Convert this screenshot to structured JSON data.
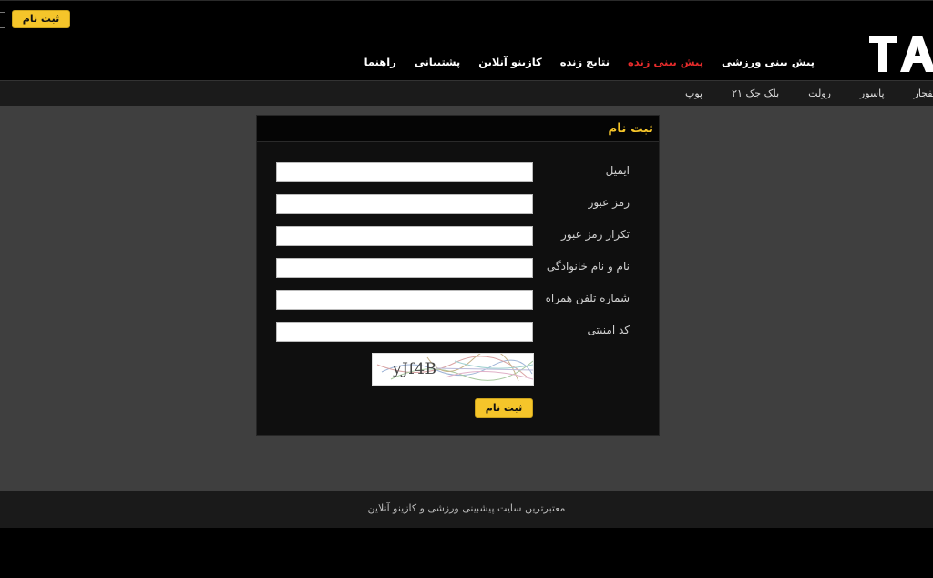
{
  "header": {
    "register_button": "ثبت نام",
    "logo_text": "TA",
    "nav": [
      {
        "label": "پیش بینی ورزشی"
      },
      {
        "label": "پیش بینی زنده"
      },
      {
        "label": "نتایج زنده"
      },
      {
        "label": "کازینو آنلاین"
      },
      {
        "label": "پشتیبانی"
      },
      {
        "label": "راهنما"
      }
    ],
    "nav_active_index": 1
  },
  "subnav": {
    "items": [
      {
        "label": "انفجار"
      },
      {
        "label": "پاسور"
      },
      {
        "label": "رولت"
      },
      {
        "label": "بلک جک ۲۱"
      },
      {
        "label": "پوپ"
      }
    ]
  },
  "form": {
    "title": "ثبت نام",
    "fields": [
      {
        "label": "ایمیل",
        "value": "",
        "placeholder": ""
      },
      {
        "label": "رمز عبور",
        "value": "",
        "placeholder": ""
      },
      {
        "label": "تکرار رمز عبور",
        "value": "",
        "placeholder": ""
      },
      {
        "label": "نام و نام خانوادگی",
        "value": "",
        "placeholder": ""
      },
      {
        "label": "شماره تلفن همراه",
        "value": "",
        "placeholder": ""
      },
      {
        "label": "کد امنیتی",
        "value": "",
        "placeholder": ""
      }
    ],
    "captcha_text": "yJf4B",
    "submit_label": "ثبت نام"
  },
  "footer": {
    "text": "معتبرترین سایت پیشبینی ورزشی و کازینو آنلاین"
  },
  "colors": {
    "accent": "#f5c52a",
    "active_nav": "#e52b2b",
    "page_bg": "#3f3f3f"
  }
}
